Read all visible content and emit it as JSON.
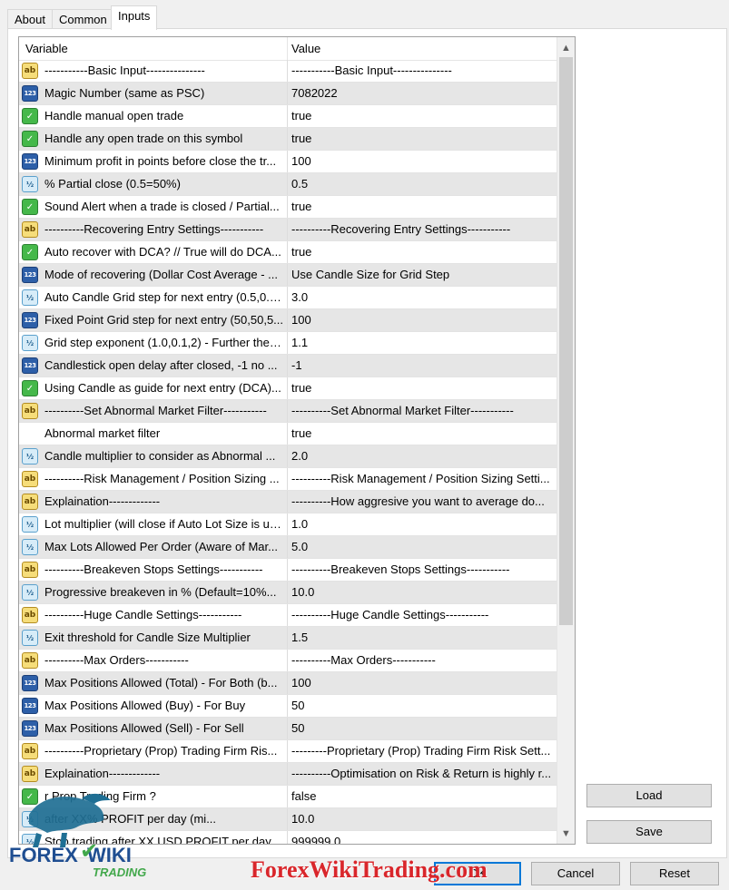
{
  "tabs": [
    "About",
    "Common",
    "Inputs"
  ],
  "grid": {
    "header": {
      "variable": "Variable",
      "value": "Value"
    },
    "rows": [
      {
        "icon": "string-type-icon",
        "variable": "-----------Basic Input---------------",
        "value": "-----------Basic Input---------------"
      },
      {
        "icon": "integer-type-icon",
        "variable": "Magic Number (same as PSC)",
        "value": "7082022"
      },
      {
        "icon": "bool-type-icon",
        "variable": "Handle manual open trade",
        "value": "true"
      },
      {
        "icon": "bool-type-icon",
        "variable": "Handle any open trade on this symbol",
        "value": "true"
      },
      {
        "icon": "integer-type-icon",
        "variable": "Minimum profit in points before close the tr...",
        "value": "100"
      },
      {
        "icon": "double-type-icon",
        "variable": "% Partial close (0.5=50%)",
        "value": "0.5"
      },
      {
        "icon": "bool-type-icon",
        "variable": "Sound Alert when a trade is closed / Partial...",
        "value": "true"
      },
      {
        "icon": "string-type-icon",
        "variable": "----------Recovering Entry Settings-----------",
        "value": "----------Recovering Entry Settings-----------"
      },
      {
        "icon": "bool-type-icon",
        "variable": "Auto recover with DCA? // True will do DCA...",
        "value": "true"
      },
      {
        "icon": "integer-type-icon",
        "variable": "Mode of recovering (Dollar Cost Average - ...",
        "value": "Use Candle Size for Grid Step"
      },
      {
        "icon": "double-type-icon",
        "variable": "Auto Candle Grid step for next entry (0.5,0.5,...",
        "value": "3.0"
      },
      {
        "icon": "integer-type-icon",
        "variable": "Fixed Point Grid step for next entry (50,50,5...",
        "value": "100"
      },
      {
        "icon": "double-type-icon",
        "variable": "Grid step exponent (1.0,0.1,2) - Further the g...",
        "value": "1.1"
      },
      {
        "icon": "integer-type-icon",
        "variable": "Candlestick open delay after closed, -1 no ...",
        "value": "-1"
      },
      {
        "icon": "bool-type-icon",
        "variable": "Using Candle as guide for next entry (DCA)...",
        "value": "true"
      },
      {
        "icon": "string-type-icon",
        "variable": "----------Set Abnormal Market Filter-----------",
        "value": "----------Set Abnormal Market Filter-----------"
      },
      {
        "icon": "none",
        "variable": "Abnormal market filter",
        "value": "true"
      },
      {
        "icon": "double-type-icon",
        "variable": "Candle multiplier to consider as Abnormal ...",
        "value": "2.0"
      },
      {
        "icon": "string-type-icon",
        "variable": "----------Risk Management / Position Sizing ...",
        "value": "----------Risk Management / Position Sizing Setti..."
      },
      {
        "icon": "string-type-icon",
        "variable": "Explaination-------------",
        "value": "----------How aggresive you want to average do..."
      },
      {
        "icon": "double-type-icon",
        "variable": "Lot multiplier (will close if Auto Lot Size is us...",
        "value": "1.0"
      },
      {
        "icon": "double-type-icon",
        "variable": "Max Lots Allowed Per Order (Aware of Mar...",
        "value": "5.0"
      },
      {
        "icon": "string-type-icon",
        "variable": "----------Breakeven Stops Settings-----------",
        "value": "----------Breakeven Stops Settings-----------"
      },
      {
        "icon": "double-type-icon",
        "variable": "Progressive breakeven in % (Default=10%...",
        "value": "10.0"
      },
      {
        "icon": "string-type-icon",
        "variable": "----------Huge Candle Settings-----------",
        "value": "----------Huge Candle Settings-----------"
      },
      {
        "icon": "double-type-icon",
        "variable": "Exit threshold for Candle Size Multiplier",
        "value": "1.5"
      },
      {
        "icon": "string-type-icon",
        "variable": "----------Max Orders-----------",
        "value": "----------Max Orders-----------"
      },
      {
        "icon": "integer-type-icon",
        "variable": "Max Positions Allowed (Total) - For Both (b...",
        "value": "100"
      },
      {
        "icon": "integer-type-icon",
        "variable": "Max Positions Allowed (Buy) - For Buy",
        "value": "50"
      },
      {
        "icon": "integer-type-icon",
        "variable": "Max Positions Allowed (Sell) - For Sell",
        "value": "50"
      },
      {
        "icon": "string-type-icon",
        "variable": "----------Proprietary (Prop) Trading Firm Ris...",
        "value": "---------Proprietary (Prop) Trading Firm Risk Sett..."
      },
      {
        "icon": "string-type-icon",
        "variable": "Explaination-------------",
        "value": "----------Optimisation on Risk & Return is highly r..."
      },
      {
        "icon": "bool-type-icon",
        "variable": "r Prop Trading Firm ?",
        "value": "false"
      },
      {
        "icon": "double-type-icon",
        "variable": "after XX% PROFIT per day (mi...",
        "value": "10.0"
      },
      {
        "icon": "double-type-icon",
        "variable": "Stop trading after XX USD PROFIT per day",
        "value": "999999.0"
      }
    ]
  },
  "buttons": {
    "load": "Load",
    "save": "Save",
    "ok": "OK",
    "cancel": "Cancel",
    "reset": "Reset"
  },
  "watermark": {
    "logo_top": "FOREX",
    "logo_right": "WIKI",
    "logo_sub": "TRADING",
    "site": "ForexWikiTrading.com"
  },
  "colors": {
    "alt_row": "#e6e6e6",
    "accent": "#0078d7",
    "watermark_red": "#d9262b"
  }
}
